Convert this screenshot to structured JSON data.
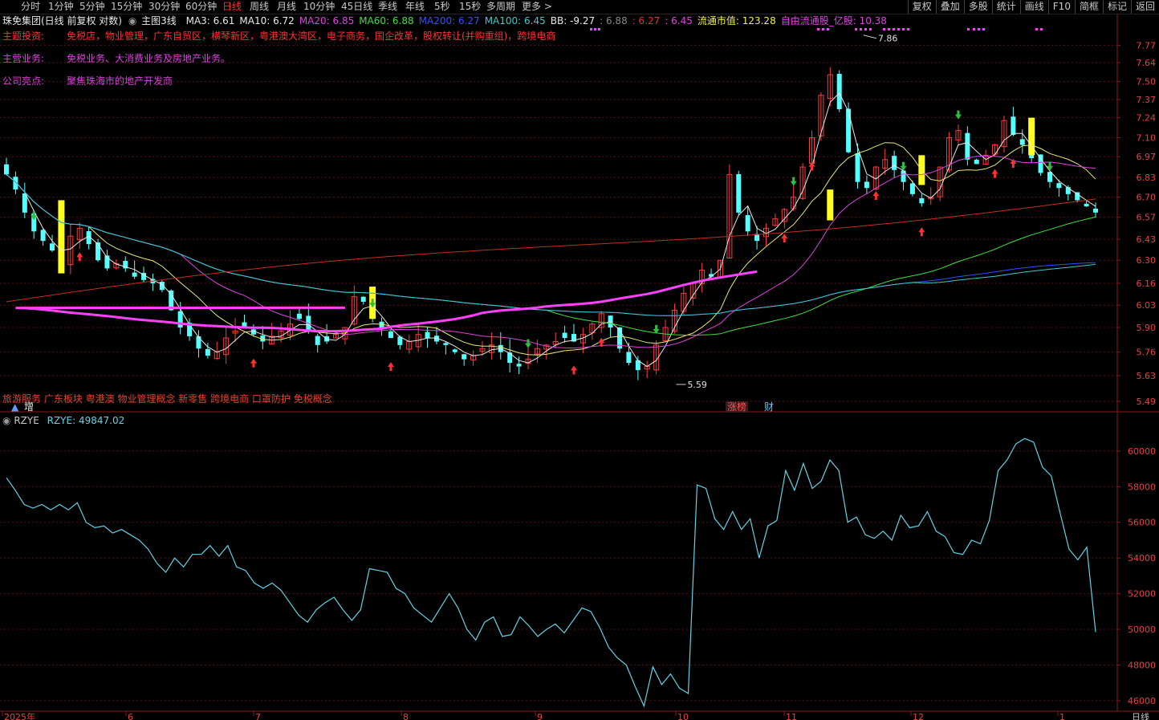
{
  "toolbar": {
    "periods": [
      "分时",
      "1分钟",
      "5分钟",
      "15分钟",
      "30分钟",
      "60分钟",
      "日线",
      "周线",
      "月线",
      "10分钟",
      "45日线",
      "季线",
      "年线",
      "5秒",
      "15秒",
      "多周期",
      "更多 >"
    ],
    "active_period": "日线",
    "right_buttons": [
      "复权",
      "叠加",
      "多股",
      "统计",
      "画线",
      "F10",
      "简框",
      "标记",
      "返回"
    ]
  },
  "header": {
    "stock": "珠免集团(日线 前复权 对数)",
    "template": "主图3线",
    "indicators": [
      {
        "text": "MA3: 6.61",
        "color": "#e8e8e8"
      },
      {
        "text": "MA10: 6.72",
        "color": "#e8e8e8"
      },
      {
        "text": "MA20: 6.85",
        "color": "#e040e0"
      },
      {
        "text": "MA60: 6.88",
        "color": "#40e040"
      },
      {
        "text": "MA200: 6.27",
        "color": "#3050ff"
      },
      {
        "text": "MA100: 6.45",
        "color": "#40c8c8"
      },
      {
        "text": "BB: -9.27",
        "color": "#e8e8e8"
      },
      {
        "text": ": 6.88",
        "color": "#888888"
      },
      {
        "text": ": 6.27",
        "color": "#e03030"
      },
      {
        "text": ": 6.45",
        "color": "#e040e0"
      },
      {
        "text": "流通市值: 123.28",
        "color": "#f0f040"
      },
      {
        "text": "自由流通股_亿股: 10.38",
        "color": "#e040e0"
      }
    ]
  },
  "notes": [
    {
      "label": "主题投资:",
      "text": "免税店，物业管理，广东自贸区，横琴新区，粤港澳大湾区，电子商务，国企改革，股权转让(并购重组)，跨境电商",
      "color": "#ff3030",
      "label_color": "#ff3030"
    },
    {
      "label": "主营业务:",
      "text": "免税业务、大消费业务及房地产业务。",
      "color": "#e040e0",
      "label_color": "#e040e0"
    },
    {
      "label": "公司亮点:",
      "text": "聚焦珠海市的地产开发商",
      "color": "#e040e0",
      "label_color": "#e040e0"
    }
  ],
  "concept_tags": "旅游服务 广东板块 粤港澳 物业管理概念 新零售 跨境电商 口罩防护 免税概念",
  "bottom_markers": {
    "left": "增",
    "mid1": "涨榜",
    "mid2": "财"
  },
  "annotations": {
    "high": "7.86",
    "low": "5.59"
  },
  "sub_header": {
    "name": "RZYE",
    "value": "RZYE: 49847.02"
  },
  "x_axis": {
    "months": [
      "2025年",
      "6",
      "7",
      "8",
      "9",
      "10",
      "11",
      "12",
      "1"
    ],
    "right_label": "日线"
  },
  "chart_data": [
    {
      "type": "candlestick",
      "title": "珠免集团(日线 前复权 对数)",
      "ylabels": [
        "7.77",
        "7.64",
        "7.50",
        "7.37",
        "7.24",
        "7.10",
        "6.97",
        "6.83",
        "6.70",
        "6.57",
        "6.43",
        "6.30",
        "6.16",
        "6.03",
        "5.90",
        "5.76",
        "5.63",
        "5.49"
      ],
      "ylim": [
        5.46,
        7.92
      ],
      "high": 7.86,
      "low": 5.59,
      "close_path": [
        6.85,
        6.75,
        6.6,
        6.48,
        6.42,
        6.36,
        6.3,
        6.45,
        6.5,
        6.4,
        6.3,
        6.25,
        6.28,
        6.25,
        6.2,
        6.18,
        6.16,
        6.12,
        6.0,
        5.9,
        5.85,
        5.78,
        5.74,
        5.76,
        5.84,
        5.88,
        5.9,
        5.86,
        5.82,
        5.85,
        5.88,
        5.92,
        5.95,
        5.88,
        5.8,
        5.82,
        5.86,
        5.9,
        6.08,
        6.05,
        5.95,
        5.9,
        5.84,
        5.8,
        5.82,
        5.86,
        5.84,
        5.82,
        5.8,
        5.76,
        5.72,
        5.74,
        5.78,
        5.8,
        5.76,
        5.7,
        5.68,
        5.72,
        5.78,
        5.8,
        5.82,
        5.84,
        5.82,
        5.86,
        5.92,
        5.98,
        5.9,
        5.78,
        5.7,
        5.66,
        5.68,
        5.8,
        5.9,
        6.0,
        6.1,
        6.16,
        6.24,
        6.2,
        6.3,
        6.85,
        6.6,
        6.48,
        6.42,
        6.5,
        6.56,
        6.62,
        6.7,
        6.9,
        7.1,
        7.4,
        7.55,
        7.3,
        7.0,
        6.8,
        6.76,
        6.9,
        6.95,
        6.88,
        6.8,
        6.72,
        6.66,
        6.7,
        6.9,
        7.1,
        7.15,
        6.95,
        6.92,
        6.98,
        7.05,
        7.22,
        7.12,
        7.05,
        6.96,
        6.86,
        6.8,
        6.76,
        6.72,
        6.68,
        6.64,
        6.6
      ],
      "ma_lines": [
        {
          "name": "MA3",
          "color": "#e8e8e8"
        },
        {
          "name": "MA10",
          "color": "#e8e870"
        },
        {
          "name": "MA20",
          "color": "#e040e0"
        },
        {
          "name": "MA60",
          "color": "#40e040"
        },
        {
          "name": "MA200",
          "color": "#3050ff"
        },
        {
          "name": "MA100",
          "color": "#40c8c8"
        }
      ]
    },
    {
      "type": "line",
      "title": "RZYE",
      "ylabels": [
        "60000",
        "58000",
        "56000",
        "54000",
        "52000",
        "50000",
        "48000",
        "46000"
      ],
      "ylim": [
        45500,
        61300
      ],
      "last": 49847.02,
      "values": [
        58500,
        57800,
        57000,
        56800,
        57000,
        56700,
        57000,
        56700,
        57100,
        56000,
        55700,
        55800,
        55400,
        55600,
        55300,
        55000,
        54500,
        53700,
        53200,
        54000,
        53500,
        54200,
        54200,
        54700,
        54100,
        54700,
        53500,
        53300,
        52600,
        52300,
        52600,
        52200,
        51500,
        50800,
        50400,
        51100,
        51500,
        51800,
        51100,
        50500,
        51100,
        53400,
        53300,
        53200,
        52300,
        52000,
        51200,
        50800,
        50400,
        51200,
        52000,
        51200,
        50000,
        49400,
        50400,
        50700,
        49600,
        49700,
        50700,
        50200,
        49600,
        50000,
        50300,
        49800,
        50500,
        51200,
        51000,
        50100,
        49000,
        48400,
        48000,
        46800,
        45700,
        47900,
        46900,
        47500,
        46700,
        46400,
        58100,
        57900,
        56200,
        55600,
        56600,
        55600,
        56200,
        54000,
        55800,
        56100,
        58900,
        57800,
        59300,
        57900,
        58300,
        59500,
        58900,
        56000,
        56300,
        55300,
        55100,
        55500,
        55000,
        56400,
        55700,
        55800,
        56600,
        55500,
        55200,
        54300,
        54200,
        55000,
        54800,
        56100,
        58900,
        59500,
        60400,
        60700,
        60500,
        59100,
        58600,
        56500,
        54500,
        53900,
        54600,
        49850
      ]
    }
  ]
}
